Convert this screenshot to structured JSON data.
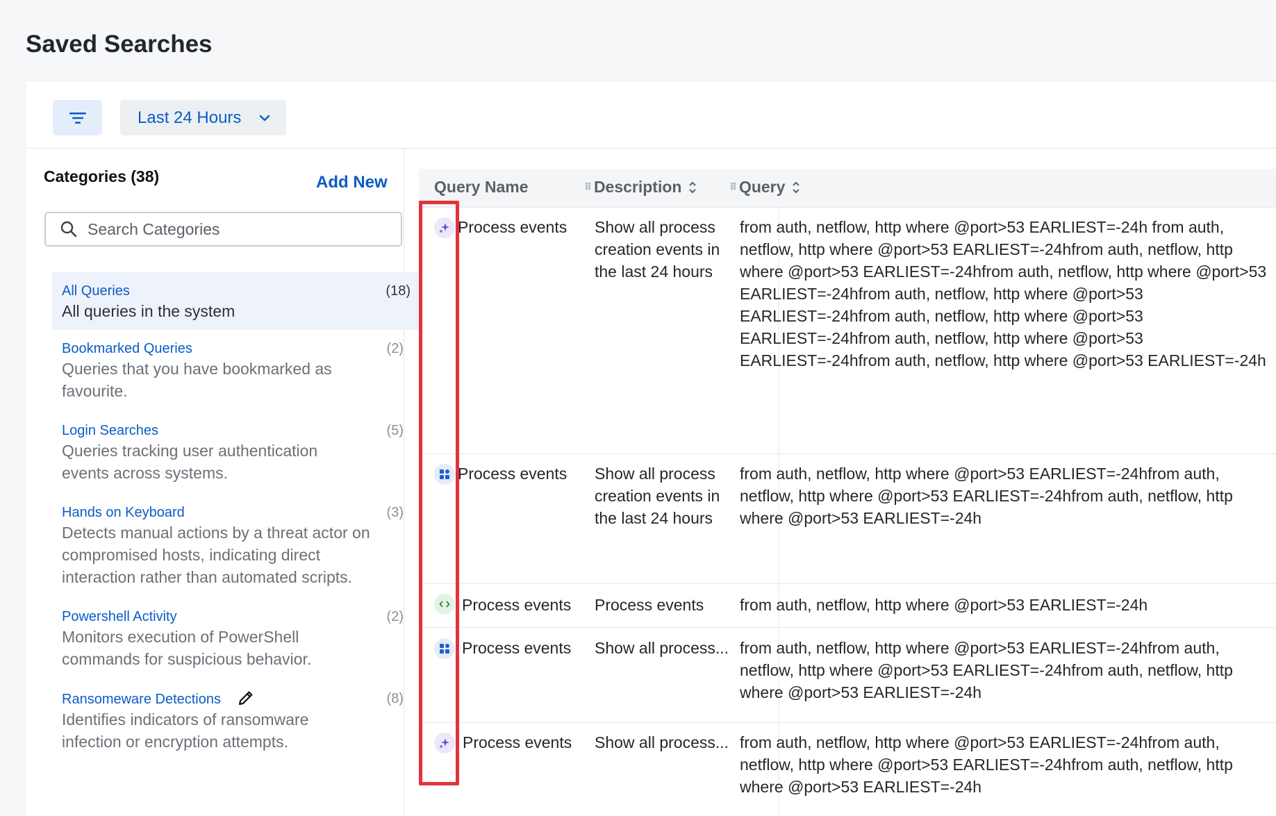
{
  "page": {
    "title": "Saved Searches"
  },
  "toolbar": {
    "filter_icon": "filter-icon",
    "time_range": "Last 24 Hours"
  },
  "sidebar": {
    "title": "Categories (38)",
    "add_new": "Add New",
    "search_placeholder": "Search Categories",
    "categories": [
      {
        "name": "All Queries",
        "count": "(18)",
        "description": "All queries in the system",
        "active": true
      },
      {
        "name": "Bookmarked Queries",
        "count": "(2)",
        "description": "Queries that you have bookmarked as favourite."
      },
      {
        "name": "Login Searches",
        "count": "(5)",
        "description": "Queries tracking user authentication events across systems."
      },
      {
        "name": "Hands on Keyboard",
        "count": "(3)",
        "description": "Detects manual actions by a threat actor on compromised hosts, indicating direct interaction rather than automated scripts."
      },
      {
        "name": "Powershell Activity",
        "count": "(2)",
        "description": "Monitors execution of PowerShell commands for suspicious behavior."
      },
      {
        "name": "Ransomeware Detections",
        "count": "(8)",
        "description": "Identifies indicators of ransomware infection or encryption attempts."
      }
    ]
  },
  "table": {
    "columns": {
      "name": "Query Name",
      "description": "Description",
      "query": "Query"
    },
    "rows": [
      {
        "icon": "sparkle-icon",
        "name": "Process events",
        "description": "Show all process creation events in the last 24 hours",
        "query": "from auth, netflow, http where @port>53 EARLIEST=-24h from auth, netflow, http where @port>53 EARLIEST=-24hfrom auth, netflow, http where @port>53 EARLIEST=-24hfrom auth, netflow, http where @port>53 EARLIEST=-24hfrom auth, netflow, http where @port>53 EARLIEST=-24hfrom auth, netflow, http where @port>53 EARLIEST=-24hfrom auth, netflow, http where @port>53 EARLIEST=-24hfrom auth, netflow, http where @port>53 EARLIEST=-24h"
      },
      {
        "icon": "grid-icon",
        "name": "Process events",
        "description": "Show all process creation events in the last 24 hours",
        "query": "from auth, netflow, http where @port>53 EARLIEST=-24hfrom auth, netflow, http where @port>53 EARLIEST=-24hfrom auth, netflow, http where @port>53 EARLIEST=-24h"
      },
      {
        "icon": "code-icon",
        "name": "Process events",
        "description": "Process events",
        "query": "from auth, netflow, http where @port>53 EARLIEST=-24h"
      },
      {
        "icon": "grid-icon",
        "name": "Process events",
        "description": "Show all process...",
        "query": "from auth, netflow, http where @port>53 EARLIEST=-24hfrom auth, netflow, http where @port>53 EARLIEST=-24hfrom auth, netflow, http where @port>53 EARLIEST=-24h"
      },
      {
        "icon": "sparkle-icon",
        "name": "Process events",
        "description": "Show all process...",
        "query": "from auth, netflow, http where @port>53 EARLIEST=-24hfrom auth, netflow, http where @port>53 EARLIEST=-24hfrom auth, netflow, http where @port>53 EARLIEST=-24h"
      }
    ]
  },
  "colors": {
    "accent": "#0b5cc7",
    "highlight": "#e5323a"
  }
}
